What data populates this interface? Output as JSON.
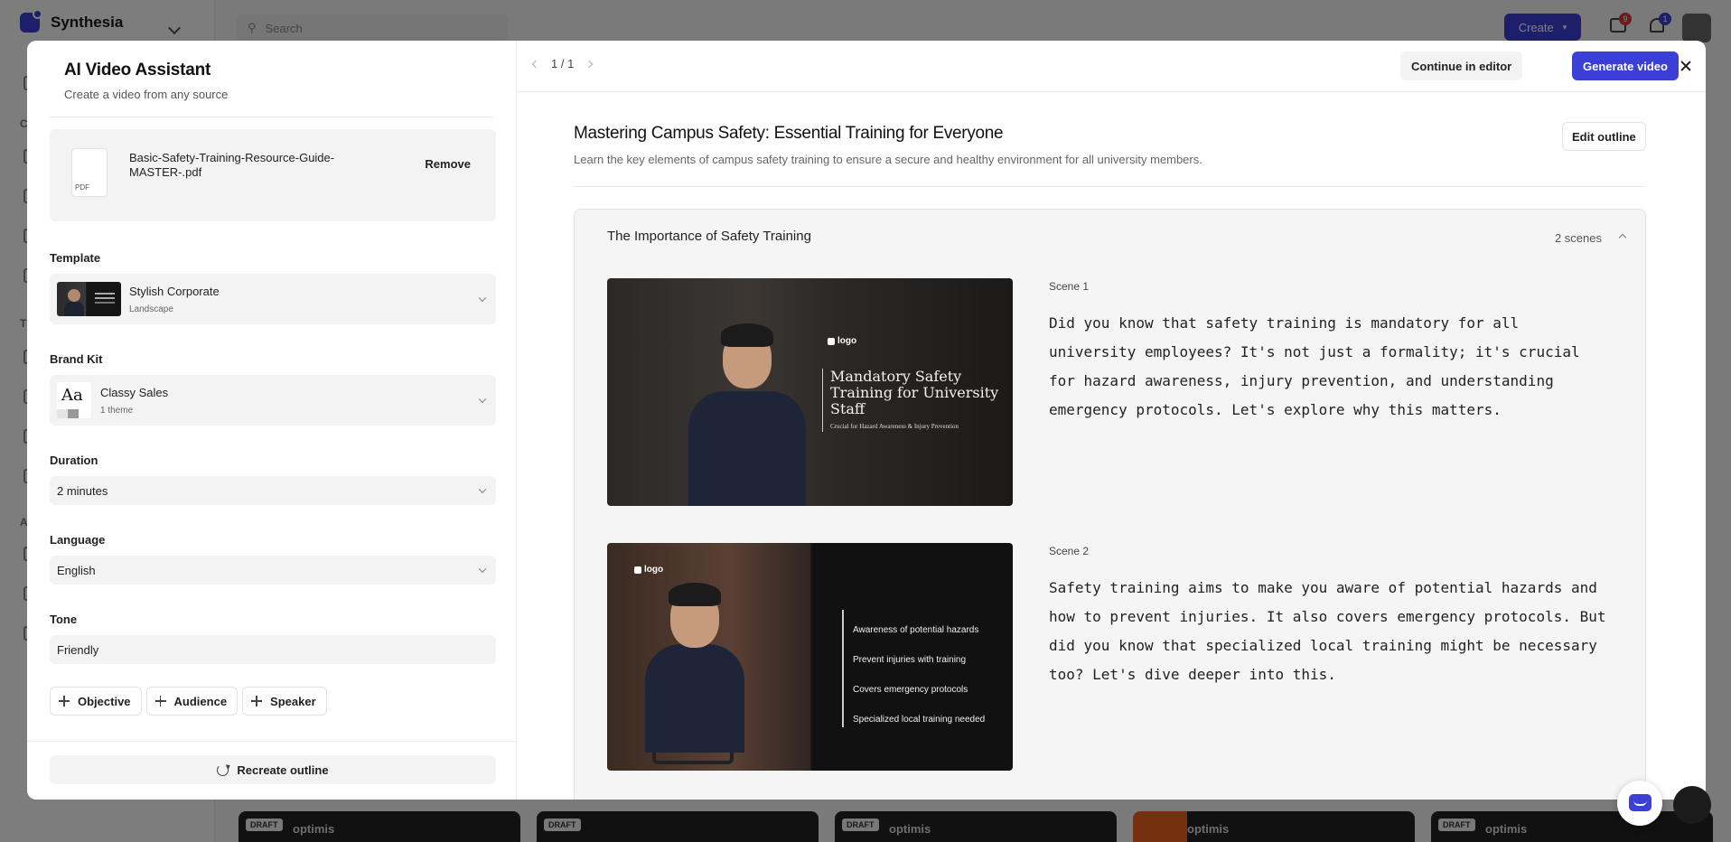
{
  "background": {
    "brand": {
      "name": "Synthesia"
    },
    "search": {
      "placeholder": "Search"
    },
    "create_button": "Create",
    "notifications": {
      "messages_count": "9",
      "bell_count": "1"
    },
    "sidebar_letters": [
      "C",
      "T",
      "A"
    ],
    "cards": [
      {
        "badge": "DRAFT",
        "brand": "optimis"
      },
      {
        "badge": "DRAFT",
        "brand": ""
      },
      {
        "badge": "DRAFT",
        "brand": "optimis"
      },
      {
        "badge": "",
        "brand": "optimis"
      },
      {
        "badge": "DRAFT",
        "brand": "optimis"
      }
    ],
    "colors": {
      "accent": "#3b3fd6",
      "orange": "#e8611e"
    }
  },
  "assistant": {
    "title": "AI Video Assistant",
    "subtitle": "Create a video from any source",
    "file": {
      "name": "Basic-Safety-Training-Resource-Guide-MASTER-.pdf",
      "type_label": "PDF",
      "remove_label": "Remove"
    },
    "template": {
      "label": "Template",
      "name": "Stylish Corporate",
      "orientation": "Landscape"
    },
    "brand_kit": {
      "label": "Brand Kit",
      "name": "Classy Sales",
      "themes": "1 theme",
      "preview_text": "Aa"
    },
    "duration": {
      "label": "Duration",
      "value": "2 minutes"
    },
    "language": {
      "label": "Language",
      "value": "English"
    },
    "tone": {
      "label": "Tone",
      "value": "Friendly"
    },
    "chips": {
      "objective": "Objective",
      "audience": "Audience",
      "speaker": "Speaker"
    },
    "recreate_label": "Recreate outline"
  },
  "outline": {
    "pager": "1 / 1",
    "continue_label": "Continue in editor",
    "generate_label": "Generate video",
    "title": "Mastering Campus Safety: Essential Training for Everyone",
    "description": "Learn the key elements of campus safety training to ensure a secure and healthy environment for all university members.",
    "edit_label": "Edit outline",
    "section": {
      "title": "The Importance of Safety Training",
      "scene_count": "2 scenes",
      "scenes": [
        {
          "label": "Scene 1",
          "text": "Did you know that safety training is mandatory for all university employees? It's not just a formality; it's crucial for hazard awareness, injury prevention, and understanding emergency protocols. Let's explore why this matters.",
          "thumb_logo": "logo",
          "thumb_title": "Mandatory Safety Training for University Staff",
          "thumb_subtitle": "Crucial for Hazard Awareness & Injury Prevention"
        },
        {
          "label": "Scene 2",
          "text": "Safety training aims to make you aware of potential hazards and how to prevent injuries. It also covers emergency protocols. But did you know that specialized local training might be necessary too? Let's dive deeper into this.",
          "thumb_logo": "logo",
          "thumb_bullets": [
            "Awareness of potential hazards",
            "Prevent injuries with training",
            "Covers emergency protocols",
            "Specialized local training needed"
          ]
        }
      ]
    }
  }
}
